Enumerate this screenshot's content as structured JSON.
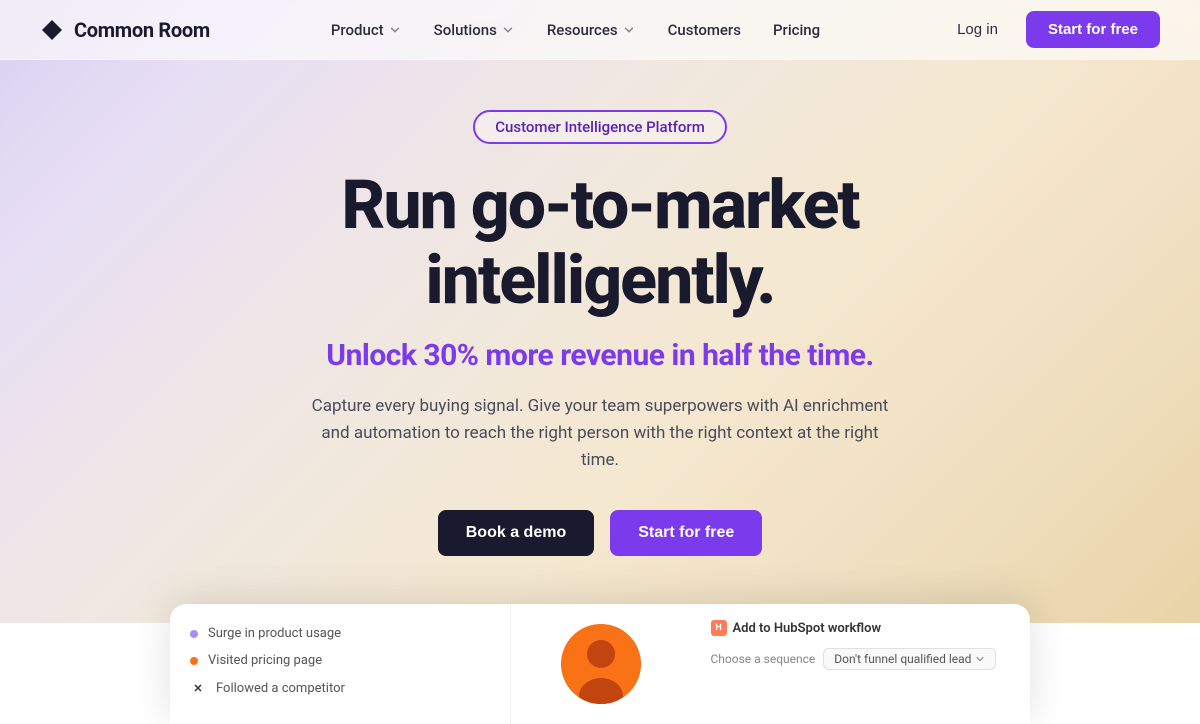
{
  "brand": {
    "name": "Common Room",
    "logo_alt": "Common Room logo"
  },
  "nav": {
    "links": [
      {
        "id": "product",
        "label": "Product",
        "has_dropdown": true
      },
      {
        "id": "solutions",
        "label": "Solutions",
        "has_dropdown": true
      },
      {
        "id": "resources",
        "label": "Resources",
        "has_dropdown": true
      },
      {
        "id": "customers",
        "label": "Customers",
        "has_dropdown": false
      },
      {
        "id": "pricing",
        "label": "Pricing",
        "has_dropdown": false
      }
    ],
    "login_label": "Log in",
    "cta_label": "Start for free"
  },
  "hero": {
    "badge": "Customer Intelligence Platform",
    "title_line1": "Run go-to-market",
    "title_line2": "intelligently.",
    "subtitle": "Unlock 30% more revenue in half the time.",
    "description": "Capture every buying signal. Give your team superpowers with AI enrichment and automation to reach the right person with the right context at the right time.",
    "cta_demo": "Book a demo",
    "cta_free": "Start for free"
  },
  "preview": {
    "items": [
      {
        "icon": "dot-purple",
        "label": "Surge in product usage"
      },
      {
        "icon": "dot-orange",
        "label": "Visited pricing page"
      },
      {
        "icon": "dot-x",
        "label": "Followed a competitor"
      }
    ],
    "right": {
      "title": "Add to HubSpot workflow",
      "sequence_label": "Choose a sequence",
      "sequence_placeholder": "Don't funnel qualified lead"
    }
  },
  "colors": {
    "purple": "#7c3aed",
    "dark": "#1a1a2e",
    "text": "#4a4a5a"
  }
}
